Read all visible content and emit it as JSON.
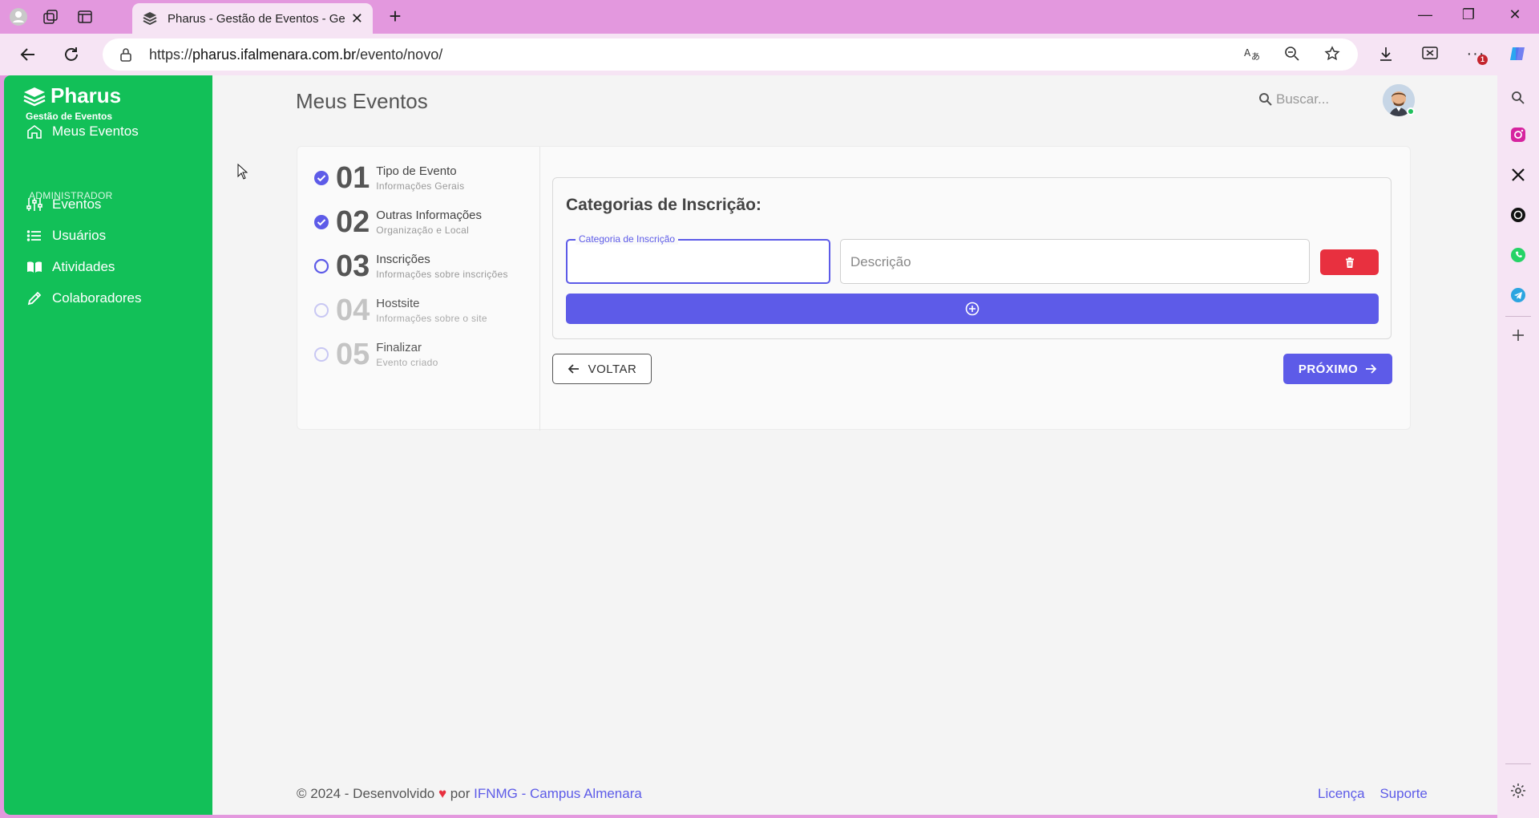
{
  "browser": {
    "tab_title": "Pharus - Gestão de Eventos - Gestão de Eventos",
    "url_prefix": "https://",
    "url_host": "pharus.ifalmenara.com.br",
    "url_path": "/evento/novo/",
    "notification_count": "1"
  },
  "sidebar": {
    "brand": "Pharus",
    "brand_sub": "Gestão de Eventos",
    "home_label": "Meus Eventos",
    "section_label": "ADMINISTRADOR",
    "items": [
      {
        "label": "Eventos"
      },
      {
        "label": "Usuários"
      },
      {
        "label": "Atividades"
      },
      {
        "label": "Colaboradores"
      }
    ]
  },
  "header": {
    "title": "Meus Eventos",
    "search_placeholder": "Buscar..."
  },
  "steps": [
    {
      "num": "01",
      "title": "Tipo de Evento",
      "subtitle": "Informações Gerais",
      "state": "done"
    },
    {
      "num": "02",
      "title": "Outras Informações",
      "subtitle": "Organização e Local",
      "state": "done"
    },
    {
      "num": "03",
      "title": "Inscrições",
      "subtitle": "Informações sobre inscrições",
      "state": "current"
    },
    {
      "num": "04",
      "title": "Hostsite",
      "subtitle": "Informações sobre o site",
      "state": "pending"
    },
    {
      "num": "05",
      "title": "Finalizar",
      "subtitle": "Evento criado",
      "state": "pending"
    }
  ],
  "form": {
    "title": "Categorias de Inscrição:",
    "category_label": "Categoria de Inscrição",
    "category_value": "",
    "description_placeholder": "Descrição"
  },
  "actions": {
    "back_label": "VOLTAR",
    "next_label": "PRÓXIMO"
  },
  "footer": {
    "copyright": "© 2024 - Desenvolvido",
    "heart": "♥",
    "by": "por",
    "org_link": "IFNMG - Campus Almenara",
    "license": "Licença",
    "support": "Suporte"
  },
  "colors": {
    "sidebar": "#12c058",
    "primary": "#5d5be8",
    "danger": "#e8303f",
    "browser_frame": "#e398de"
  }
}
